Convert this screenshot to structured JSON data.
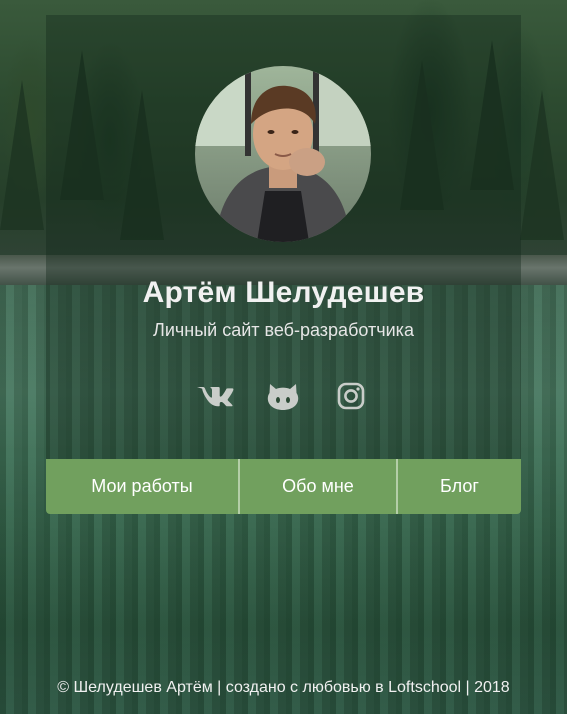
{
  "profile": {
    "name": "Артём Шелудешев",
    "subtitle": "Личный сайт веб-разработчика"
  },
  "socials": [
    {
      "icon": "vk-icon",
      "label": "VK"
    },
    {
      "icon": "github-icon",
      "label": "GitHub"
    },
    {
      "icon": "instagram-icon",
      "label": "Instagram"
    }
  ],
  "nav": {
    "items": [
      {
        "label": "Мои работы"
      },
      {
        "label": "Обо мне"
      },
      {
        "label": "Блог"
      }
    ]
  },
  "footer": {
    "text": "© Шелудешев Артём | создано с любовью в Loftschool | 2018"
  },
  "colors": {
    "nav_bg": "#71a05e",
    "icon": "#c9cdc9",
    "card_overlay": "rgba(18,40,26,0.38)"
  }
}
